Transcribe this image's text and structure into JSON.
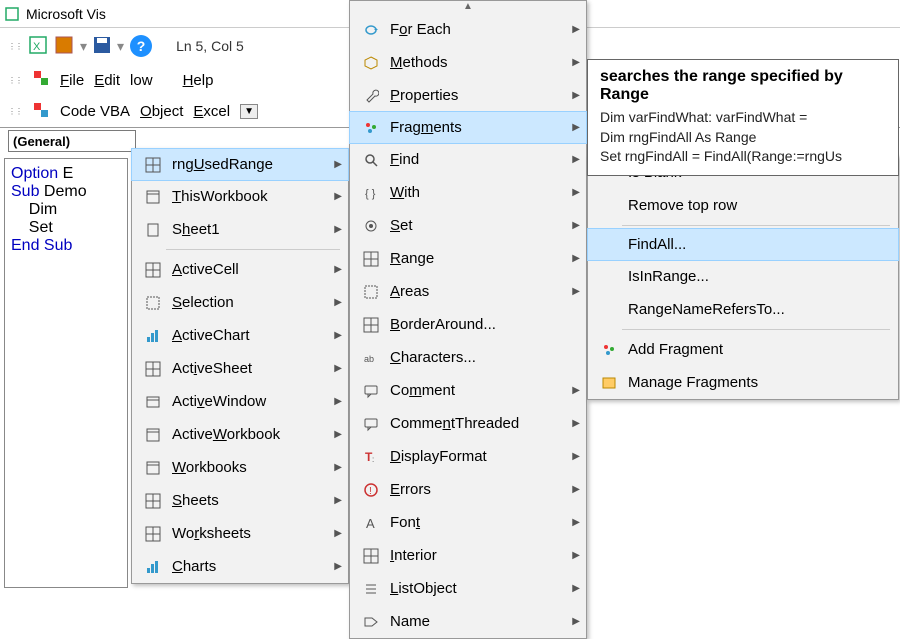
{
  "title": "Microsoft Vis",
  "status": "Ln 5, Col 5",
  "menubar": {
    "file": "File",
    "edit": "Edit",
    "low": "low",
    "help": "Help"
  },
  "toolbar": {
    "codevba": "Code VBA",
    "object": "Object",
    "excel": "Excel"
  },
  "combo": "(General)",
  "code": {
    "l1a": "Option ",
    "l1b": "E",
    "l2a": "Sub",
    "l2b": " Demo",
    "l3": "    Dim",
    "l4": "    Set",
    "l5": "",
    "l6a": "End Sub"
  },
  "menu1": [
    {
      "label": "rng<u>U</u>sedRange",
      "sub": true,
      "hover": true,
      "icon": "grid"
    },
    {
      "label": "<u>T</u>hisWorkbook",
      "sub": true,
      "icon": "book"
    },
    {
      "label": "S<u>h</u>eet1",
      "sub": true,
      "icon": "sheet"
    },
    {
      "sep": true
    },
    {
      "label": "<u>A</u>ctiveCell",
      "sub": true,
      "icon": "grid"
    },
    {
      "label": "<u>S</u>election",
      "sub": true,
      "icon": "sel"
    },
    {
      "label": "<u>A</u>ctiveChart",
      "sub": true,
      "icon": "chart"
    },
    {
      "label": "Act<u>i</u>veSheet",
      "sub": true,
      "icon": "grid"
    },
    {
      "label": "Acti<u>v</u>eWindow",
      "sub": true,
      "icon": "win"
    },
    {
      "label": "Active<u>W</u>orkbook",
      "sub": true,
      "icon": "book"
    },
    {
      "label": "<u>W</u>orkbooks",
      "sub": true,
      "icon": "book"
    },
    {
      "label": "<u>S</u>heets",
      "sub": true,
      "icon": "grid"
    },
    {
      "label": "Wo<u>r</u>ksheets",
      "sub": true,
      "icon": "grid"
    },
    {
      "label": "<u>C</u>harts",
      "sub": true,
      "icon": "chart"
    }
  ],
  "menu2": [
    {
      "label": "F<u>o</u>r Each",
      "sub": true,
      "icon": "loop"
    },
    {
      "label": "<u>M</u>ethods",
      "sub": true,
      "icon": "cube"
    },
    {
      "label": "<u>P</u>roperties",
      "sub": true,
      "icon": "wrench"
    },
    {
      "label": "Frag<u>m</u>ents",
      "sub": true,
      "hover": true,
      "icon": "frag"
    },
    {
      "label": "<u>F</u>ind",
      "sub": true,
      "icon": "search"
    },
    {
      "label": "<u>W</u>ith",
      "sub": true,
      "icon": "code"
    },
    {
      "label": "<u>S</u>et",
      "sub": true,
      "icon": "target"
    },
    {
      "label": "<u>R</u>ange",
      "sub": true,
      "icon": "grid"
    },
    {
      "label": "<u>A</u>reas",
      "sub": true,
      "icon": "sel"
    },
    {
      "label": "<u>B</u>orderAround...",
      "icon": "grid"
    },
    {
      "label": "<u>C</u>haracters...",
      "icon": "abc"
    },
    {
      "label": "Co<u>m</u>ment",
      "sub": true,
      "icon": "comment"
    },
    {
      "label": "Comme<u>n</u>tThreaded",
      "sub": true,
      "icon": "comment"
    },
    {
      "label": "<u>D</u>isplayFormat",
      "sub": true,
      "icon": "tformat"
    },
    {
      "label": "<u>E</u>rrors",
      "sub": true,
      "icon": "error"
    },
    {
      "label": "Fon<u>t</u>",
      "sub": true,
      "icon": "font"
    },
    {
      "label": "<u>I</u>nterior",
      "sub": true,
      "icon": "grid"
    },
    {
      "label": "<u>L</u>istObject",
      "sub": true,
      "icon": "list"
    },
    {
      "label": "Name",
      "sub": true,
      "icon": "tag"
    }
  ],
  "menu3": [
    {
      "label": "Is Blank"
    },
    {
      "label": "Remove top row"
    },
    {
      "sep": true
    },
    {
      "label": "FindAll...",
      "hover": true
    },
    {
      "label": "IsInRange..."
    },
    {
      "label": "RangeNameRefersTo..."
    },
    {
      "sep": true
    },
    {
      "label": "Add Fragment",
      "icon": "frag"
    },
    {
      "label": "Manage Fragments",
      "icon": "manage"
    }
  ],
  "tooltip": {
    "title": "searches the range specified by Range",
    "body": "Dim varFindWhat: varFindWhat =\nDim rngFindAll As Range\nSet rngFindAll = FindAll(Range:=rngUs"
  }
}
